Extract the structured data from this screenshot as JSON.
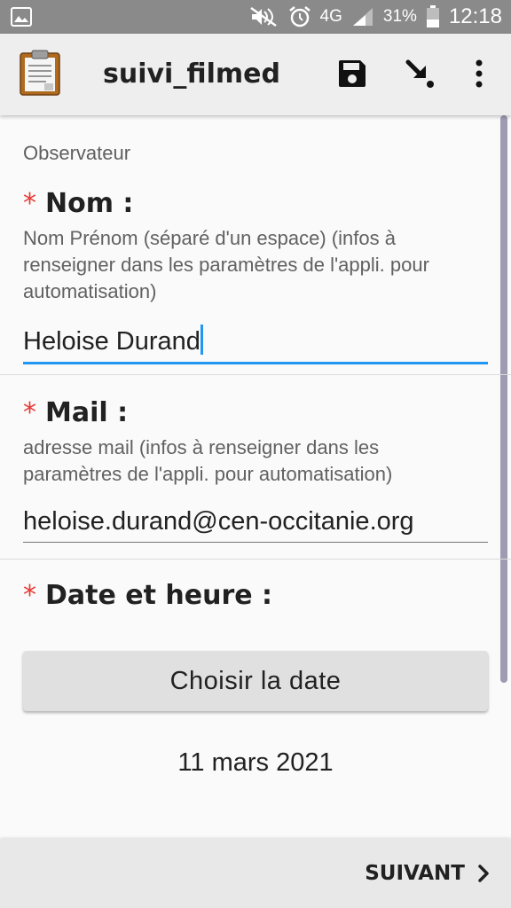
{
  "status_bar": {
    "network": "4G",
    "battery": "31%",
    "time": "12:18",
    "icons": [
      "image-icon",
      "mute-icon",
      "alarm-icon",
      "signal-icon",
      "battery-icon"
    ]
  },
  "app_bar": {
    "title": "suivi_filmed",
    "icons": [
      "clipboard-icon",
      "save-icon",
      "load-arrow-icon",
      "more-vert-icon"
    ]
  },
  "form": {
    "group_label": "Observateur",
    "required_marker": "*",
    "nom": {
      "label": "Nom :",
      "hint": "Nom Prénom (séparé d'un espace) (infos à renseigner dans les paramètres de l'appli. pour automatisation)",
      "value": "Heloise Durand"
    },
    "mail": {
      "label": "Mail :",
      "hint": "adresse mail (infos à renseigner dans les paramètres de l'appli. pour automatisation)",
      "value": "heloise.durand@cen-occitanie.org"
    },
    "date": {
      "label": "Date et heure :",
      "button_label": "Choisir la date",
      "value": "11 mars 2021"
    }
  },
  "bottom_bar": {
    "next_label": "SUIVANT"
  },
  "colors": {
    "accent": "#2196f3",
    "required": "#e53935",
    "status_bar": "#8a8a8a",
    "app_bar": "#eeeeee"
  }
}
